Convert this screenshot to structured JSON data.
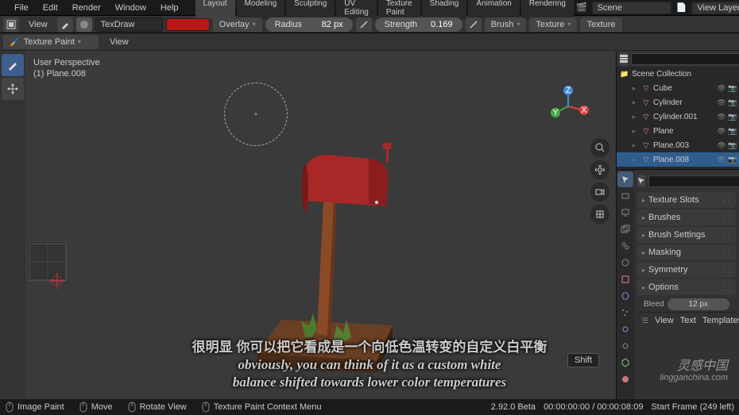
{
  "menu": [
    "File",
    "Edit",
    "Render",
    "Window",
    "Help"
  ],
  "tabs": [
    "Layout",
    "Modeling",
    "Sculpting",
    "UV Editing",
    "Texture Paint",
    "Shading",
    "Animation",
    "Rendering"
  ],
  "active_tab": "Layout",
  "scene_name": "Scene",
  "view_layer": "View Layer",
  "tex_brush_name": "TexDraw",
  "overlay_mode": "Overlay",
  "radius_label": "Radius",
  "radius_value": "82 px",
  "strength_label": "Strength",
  "strength_value": "0.169",
  "brush_color_hex": "#b91818",
  "header_dropdowns": [
    "Brush",
    "Texture",
    "Texture"
  ],
  "mode_label": "Texture Paint",
  "view_label": "View",
  "viewport": {
    "line1": "User Perspective",
    "line2": "(1) Plane.008"
  },
  "outliner": {
    "collection": "Scene Collection",
    "items": [
      {
        "name": "Cube",
        "type": "mesh",
        "selected": false
      },
      {
        "name": "Cylinder",
        "type": "mesh",
        "selected": false
      },
      {
        "name": "Cylinder.001",
        "type": "mesh",
        "selected": false
      },
      {
        "name": "Plane",
        "type": "mesh",
        "selected": false
      },
      {
        "name": "Plane.003",
        "type": "mesh",
        "selected": false
      },
      {
        "name": "Plane.008",
        "type": "mesh",
        "selected": true
      }
    ]
  },
  "props": {
    "sections": [
      "Texture Slots",
      "Brushes",
      "Brush Settings",
      "Masking",
      "Symmetry",
      "Options"
    ],
    "bleed_label": "Bleed",
    "bleed_value": "12 px",
    "footer": [
      "View",
      "Text",
      "Templates"
    ]
  },
  "status": {
    "left": [
      {
        "icon": "mouse",
        "text": "Image Paint"
      },
      {
        "icon": "mouse",
        "text": "Move"
      },
      {
        "icon": "mouse",
        "text": "Rotate View"
      },
      {
        "icon": "mouse",
        "text": "Texture Paint Context Menu"
      }
    ],
    "version": "2.92.0 Beta",
    "time": "00:00:00:00 / 00:00:08:09",
    "frame": "Start Frame (249 left)"
  },
  "subtitle": {
    "cn": "很明显 你可以把它看成是一个向低色温转变的自定义白平衡",
    "en1": "obviously, you can think of it as a custom white",
    "en2": "balance shifted towards lower color temperatures"
  },
  "watermark": {
    "cn": "灵感中国",
    "en": "lingganchina.com"
  },
  "shift_key": "Shift"
}
